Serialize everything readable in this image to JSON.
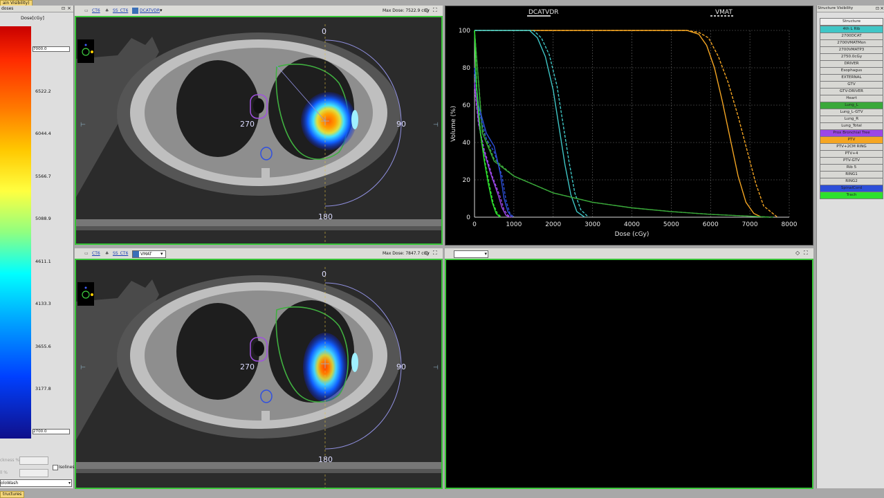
{
  "top_tab": "ain Visibility)",
  "bottom_tab": "tructures",
  "left_panel": {
    "title": "doses",
    "unit_label": "Dose[cGy]",
    "max_value": "7000.0",
    "min_value": "2700.0",
    "ticks": [
      "6522.2",
      "6044.4",
      "5566.7",
      "5088.9",
      "4611.1",
      "4133.3",
      "3655.6",
      "3177.8"
    ],
    "thickness_label": "ckness %",
    "fill_label": "ll %",
    "isolines_label": "Isolines",
    "colorwash_value": "oloWash"
  },
  "viewer_top": {
    "tab1": "CT6",
    "tab2": "SS_CT6",
    "dropdown": "DCATVDR",
    "max_dose": "Max Dose: 7522.9 cGy",
    "angles": {
      "top": "0",
      "left": "270",
      "right": "90",
      "bottom": "180"
    }
  },
  "viewer_bottom": {
    "tab1": "CT6",
    "tab2": "SS_CT6",
    "dropdown": "VMAT",
    "max_dose": "Max Dose: 7847.7 cGy",
    "angles": {
      "top": "0",
      "left": "270",
      "right": "90",
      "bottom": "180"
    }
  },
  "structure_panel": {
    "title": "Structure Visibility",
    "header": "Structure",
    "items": [
      {
        "label": "4th L Rib",
        "color": "#3fc6c6"
      },
      {
        "label": "2700DCAT",
        "color": "#d8d8d4"
      },
      {
        "label": "2700VMATMon",
        "color": "#d8d8d4"
      },
      {
        "label": "2700VMATP3",
        "color": "#d8d8d4"
      },
      {
        "label": "2750.0cGy",
        "color": "#d8d8d4"
      },
      {
        "label": "DRIVER",
        "color": "#d8d8d4"
      },
      {
        "label": "Esophagus",
        "color": "#d8d8d4"
      },
      {
        "label": "EXTERNAL",
        "color": "#d8d8d4"
      },
      {
        "label": "GTV",
        "color": "#d8d8d4"
      },
      {
        "label": "GTV-DRIVER",
        "color": "#d8d8d4"
      },
      {
        "label": "Heart",
        "color": "#d8d8d4"
      },
      {
        "label": "Lung_L",
        "color": "#3aa83a"
      },
      {
        "label": "Lung_L-GTV",
        "color": "#d8d8d4"
      },
      {
        "label": "Lung_R",
        "color": "#d8d8d4"
      },
      {
        "label": "Lung_Total",
        "color": "#d8d8d4"
      },
      {
        "label": "Prox Bronchial Tree",
        "color": "#9b47e6"
      },
      {
        "label": "PTV",
        "color": "#f5a623"
      },
      {
        "label": "PTV+2CM RING",
        "color": "#d8d8d4"
      },
      {
        "label": "PTV+4",
        "color": "#d8d8d4"
      },
      {
        "label": "PTV-GTV",
        "color": "#d8d8d4"
      },
      {
        "label": "Rib 5",
        "color": "#d8d8d4"
      },
      {
        "label": "RING1",
        "color": "#d8d8d4"
      },
      {
        "label": "RING2",
        "color": "#d8d8d4"
      },
      {
        "label": "SpinalCord",
        "color": "#2d4fd8"
      },
      {
        "label": "Trach",
        "color": "#2ee02e"
      }
    ]
  },
  "chart_data": {
    "type": "line",
    "legend": [
      "DCATVDR",
      "VMAT"
    ],
    "xlabel": "Dose (cGy)",
    "ylabel": "Volume (%)",
    "xlim": [
      0,
      8000
    ],
    "ylim": [
      0,
      100
    ],
    "xticks": [
      0,
      1000,
      2000,
      3000,
      4000,
      5000,
      6000,
      7000,
      8000
    ],
    "yticks": [
      0,
      20,
      40,
      60,
      80,
      100
    ],
    "grid": true,
    "series": [
      {
        "structure": "PTV",
        "plan": "DCATVDR",
        "color": "#f5a623",
        "dashed": false,
        "x": [
          0,
          5400,
          5700,
          5900,
          6100,
          6300,
          6500,
          6700,
          6900,
          7100,
          7300
        ],
        "y": [
          100,
          100,
          98,
          92,
          80,
          62,
          42,
          22,
          8,
          2,
          0
        ]
      },
      {
        "structure": "PTV",
        "plan": "VMAT",
        "color": "#f5a623",
        "dashed": true,
        "x": [
          0,
          5400,
          5700,
          5950,
          6200,
          6450,
          6700,
          6950,
          7150,
          7350,
          7700
        ],
        "y": [
          100,
          100,
          99,
          96,
          86,
          72,
          54,
          34,
          18,
          6,
          0
        ]
      },
      {
        "structure": "4th L Rib",
        "plan": "DCATVDR",
        "color": "#3fc6c6",
        "dashed": false,
        "x": [
          0,
          1400,
          1600,
          1800,
          2000,
          2150,
          2300,
          2450,
          2600,
          2800
        ],
        "y": [
          100,
          100,
          96,
          86,
          68,
          48,
          28,
          12,
          3,
          0
        ]
      },
      {
        "structure": "4th L Rib",
        "plan": "VMAT",
        "color": "#3fc6c6",
        "dashed": true,
        "x": [
          0,
          1500,
          1700,
          1900,
          2100,
          2250,
          2400,
          2550,
          2700,
          2900
        ],
        "y": [
          100,
          100,
          96,
          87,
          70,
          50,
          30,
          13,
          4,
          0
        ]
      },
      {
        "structure": "Lung_L",
        "plan": "DCATVDR",
        "color": "#3aa83a",
        "dashed": false,
        "x": [
          0,
          200,
          500,
          1000,
          2000,
          3000,
          4000,
          5000,
          6000,
          7000,
          7500
        ],
        "y": [
          100,
          45,
          30,
          22,
          13,
          8,
          5,
          3,
          1.5,
          0.5,
          0
        ]
      },
      {
        "structure": "Lung_L",
        "plan": "VMAT",
        "color": "#3aa83a",
        "dashed": true,
        "x": [
          0,
          200,
          500,
          1000,
          2000,
          3000,
          4000,
          5000,
          6000,
          7000,
          7600
        ],
        "y": [
          100,
          47,
          31,
          22,
          13,
          8,
          5,
          3,
          1.5,
          0.5,
          0
        ]
      },
      {
        "structure": "SpinalCord",
        "plan": "DCATVDR",
        "color": "#2d4fd8",
        "dashed": false,
        "x": [
          0,
          100,
          300,
          500,
          650,
          750,
          850,
          950
        ],
        "y": [
          80,
          60,
          45,
          38,
          24,
          10,
          3,
          0
        ]
      },
      {
        "structure": "SpinalCord",
        "plan": "VMAT",
        "color": "#2d4fd8",
        "dashed": true,
        "x": [
          0,
          100,
          300,
          500,
          700,
          800,
          900,
          1000
        ],
        "y": [
          78,
          58,
          42,
          35,
          22,
          9,
          2,
          0
        ]
      },
      {
        "structure": "Prox Bronchial Tree",
        "plan": "DCATVDR",
        "color": "#9b47e6",
        "dashed": false,
        "x": [
          0,
          100,
          200,
          400,
          600,
          700,
          800,
          900
        ],
        "y": [
          72,
          52,
          38,
          24,
          12,
          5,
          1,
          0
        ]
      },
      {
        "structure": "Prox Bronchial Tree",
        "plan": "VMAT",
        "color": "#9b47e6",
        "dashed": true,
        "x": [
          0,
          100,
          250,
          450,
          650,
          750,
          850,
          950
        ],
        "y": [
          70,
          50,
          36,
          22,
          11,
          4,
          1,
          0
        ]
      },
      {
        "structure": "Trach",
        "plan": "DCATVDR",
        "color": "#2ee02e",
        "dashed": false,
        "x": [
          0,
          50,
          150,
          250,
          350,
          450,
          550,
          650
        ],
        "y": [
          100,
          70,
          45,
          30,
          18,
          8,
          2,
          0
        ]
      },
      {
        "structure": "Trach",
        "plan": "VMAT",
        "color": "#2ee02e",
        "dashed": true,
        "x": [
          0,
          60,
          160,
          270,
          380,
          480,
          580,
          680
        ],
        "y": [
          100,
          68,
          44,
          29,
          17,
          7,
          2,
          0
        ]
      }
    ]
  }
}
